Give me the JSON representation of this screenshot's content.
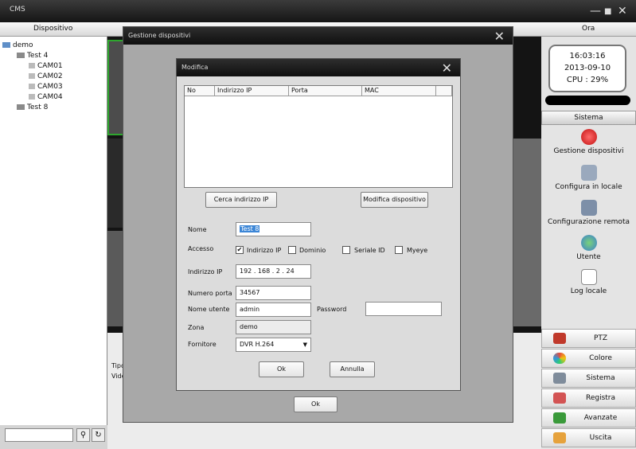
{
  "app": {
    "title": "CMS",
    "minimize": "—",
    "restore": "■",
    "close": "✕"
  },
  "header": {
    "devices_label": "Dispositivo",
    "time_label": "Ora"
  },
  "tree": [
    {
      "label": "demo",
      "level": 0
    },
    {
      "label": "Test 4",
      "level": 1
    },
    {
      "label": "CAM01",
      "level": 2
    },
    {
      "label": "CAM02",
      "level": 2
    },
    {
      "label": "CAM03",
      "level": 2
    },
    {
      "label": "CAM04",
      "level": 2
    },
    {
      "label": "Test 8",
      "level": 1
    }
  ],
  "status": {
    "time": "16:03:16",
    "date": "2013-09-10",
    "cpu": "CPU : 29%"
  },
  "right_panel": {
    "header": "Sistema",
    "items": [
      "Gestione dispositivi",
      "Configura in locale",
      "Configurazione remota",
      "Utente",
      "Log locale"
    ],
    "buttons": [
      "PTZ",
      "Colore",
      "Sistema",
      "Registra",
      "Avanzate",
      "Uscita"
    ]
  },
  "device_manager": {
    "title": "Gestione dispositivi",
    "close": "✕",
    "ok_label": "Ok"
  },
  "modify_dialog": {
    "title": "Modifica",
    "close": "✕",
    "columns": [
      "No",
      "Indirizzo IP",
      "Porta",
      "MAC"
    ],
    "search_button": "Cerca indirizzo IP",
    "modify_button": "Modifica dispositivo",
    "name_label": "Nome",
    "name_value": "Test 8",
    "access_label": "Accesso",
    "access_options": [
      {
        "label": "Indirizzo IP",
        "checked": true
      },
      {
        "label": "Dominio",
        "checked": false
      },
      {
        "label": "Seriale ID",
        "checked": false
      },
      {
        "label": "Myeye",
        "checked": false
      }
    ],
    "ip_label": "Indirizzo IP",
    "ip_value": "192 . 168 . 2 . 24",
    "port_label": "Numero porta",
    "port_value": "34567",
    "user_label": "Nome utente",
    "user_value": "admin",
    "password_label": "Password",
    "password_value": "",
    "zone_label": "Zona",
    "zone_value": "demo",
    "vendor_label": "Fornitore",
    "vendor_value": "DVR H.264",
    "ok_label": "Ok",
    "cancel_label": "Annulla"
  },
  "lower_panel": {
    "col1": "Tipo",
    "row1": "Vide"
  }
}
